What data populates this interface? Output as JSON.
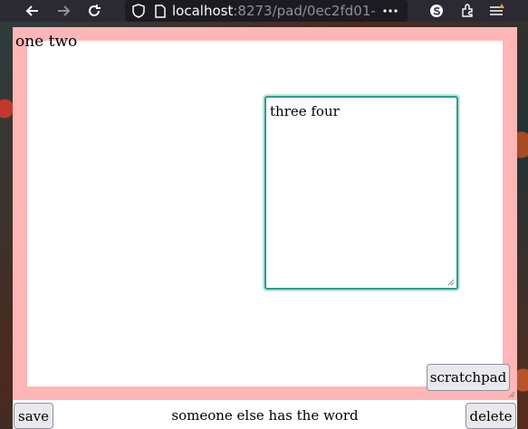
{
  "browser": {
    "url_host": "localhost",
    "url_rest": ":8273/pad/0ec2fd01-",
    "icons": [
      "back-arrow-icon",
      "forward-arrow-icon",
      "reload-icon",
      "shield-icon",
      "page-icon",
      "more-icon",
      "profile-icon",
      "extensions-icon",
      "menu-icon"
    ]
  },
  "canvas": {
    "text": "one two"
  },
  "note": {
    "text": "three four"
  },
  "buttons": {
    "scratchpad": "scratchpad",
    "save": "save",
    "delete": "delete"
  },
  "status": {
    "text": "someone else has the word"
  },
  "colors": {
    "pane_border": "#ffb6b6",
    "textarea_border": "#2a9d8f"
  }
}
